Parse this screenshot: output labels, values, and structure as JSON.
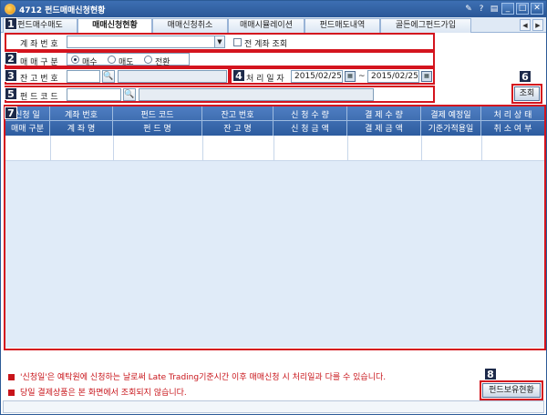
{
  "window": {
    "title": "4712 펀드매매신청현황"
  },
  "titlebar_icons": {
    "pin": "✎",
    "help": "?",
    "menu": "▤",
    "minimize": "_",
    "maximize": "□",
    "close": "✕"
  },
  "tabs": [
    {
      "label": "펀드매수매도"
    },
    {
      "label": "매매신청현황"
    },
    {
      "label": "매매신청취소"
    },
    {
      "label": "매매시뮬레이션"
    },
    {
      "label": "펀드매도내역"
    },
    {
      "label": "골든에그펀드가입"
    }
  ],
  "tab_scroll": {
    "left": "◀",
    "right": "▶"
  },
  "badges": [
    "1",
    "2",
    "3",
    "4",
    "5",
    "6",
    "7",
    "8"
  ],
  "account": {
    "label": "계 좌 번 호",
    "value": "",
    "dropdown_icon": "▼",
    "all_accounts_label": "전 계좌 조회"
  },
  "trade_type": {
    "label": "매 매 구 분",
    "options": [
      "매수",
      "매도",
      "전환"
    ],
    "selected": "매수"
  },
  "balance": {
    "label": "잔 고 번 호",
    "value": "",
    "search_icon": "🔍",
    "name_value": ""
  },
  "date_range": {
    "label": "처 리 일 자",
    "from": "2015/02/25",
    "to": "2015/02/25",
    "separator": "~",
    "calendar_icon": "▦"
  },
  "fund_code": {
    "label": "펀 드 코 드",
    "value": "",
    "search_icon": "🔍",
    "name_value": ""
  },
  "search_button": {
    "label": "조회"
  },
  "grid": {
    "columns": [
      {
        "top": "신청 일",
        "bottom": "매매 구분"
      },
      {
        "top": "계좌 번호",
        "bottom": "계 좌 명"
      },
      {
        "top": "펀드 코드",
        "bottom": "펀 드 명"
      },
      {
        "top": "잔고 번호",
        "bottom": "잔 고 명"
      },
      {
        "top": "신 청 수 량",
        "bottom": "신 청 금 액"
      },
      {
        "top": "결 제 수 량",
        "bottom": "결 제 금 액"
      },
      {
        "top": "결제 예정일",
        "bottom": "기준가적용일"
      },
      {
        "top": "처 리 상 태",
        "bottom": "취 소 여 부"
      }
    ]
  },
  "notes": [
    "'신청일'은 예탁원에 신청하는 날로써 Late Trading기준시간 이후 매매신청 시 처리일과 다를 수 있습니다.",
    "당일 결제상품은 본 화면에서 조회되지 않습니다."
  ],
  "holdings_button": {
    "label": "펀드보유현황"
  },
  "colors": {
    "accent": "#2d5c9f",
    "highlight": "#d4141e",
    "note_text": "#c8141a"
  }
}
